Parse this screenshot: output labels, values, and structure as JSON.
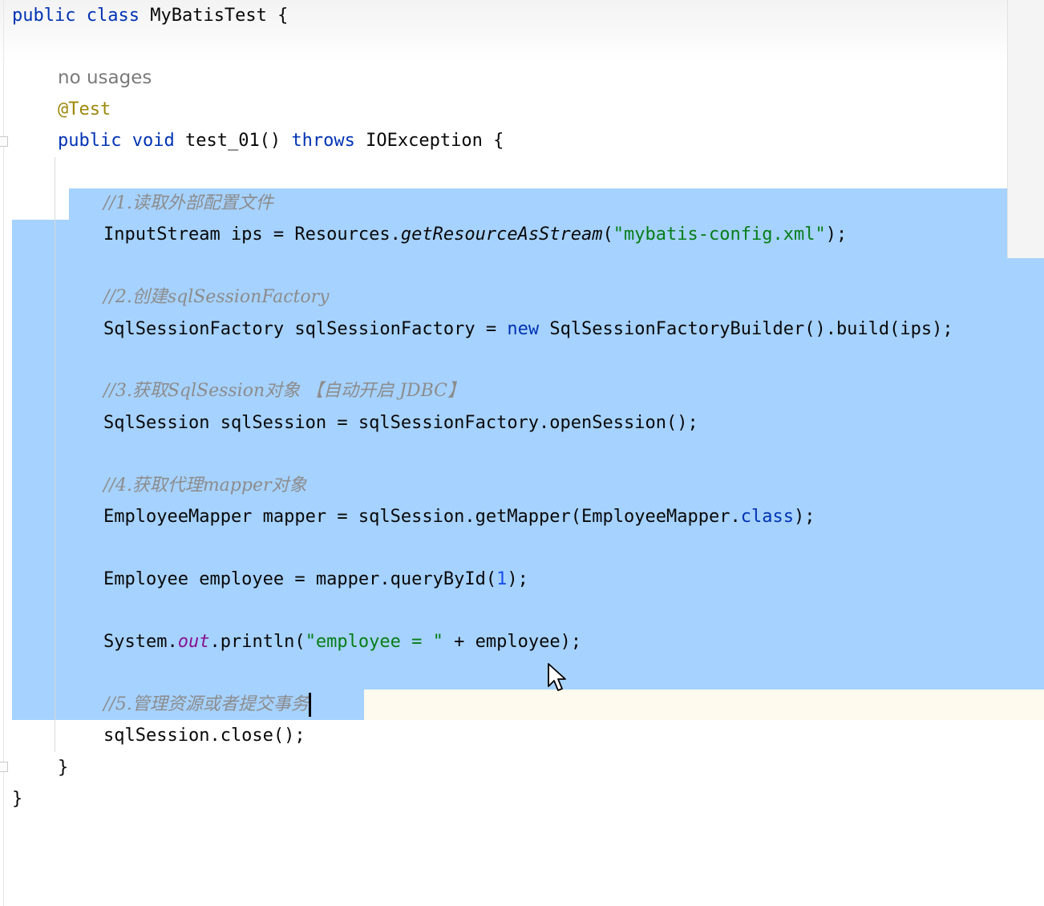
{
  "code": {
    "class_decl": {
      "kw1": "public",
      "kw2": "class",
      "name": "MyBatisTest",
      "brace": "{"
    },
    "usage_hint": "no usages",
    "annotation": "@Test",
    "method_decl": {
      "kw1": "public",
      "kw2": "void",
      "name": "test_01()",
      "kw3": "throws",
      "exception": "IOException",
      "brace": "{"
    },
    "comment1": "//1.读取外部配置文件",
    "line_ips": {
      "a": "InputStream ips = Resources.",
      "method": "getResourceAsStream",
      "b": "(",
      "str": "\"mybatis-config.xml\"",
      "c": ");"
    },
    "comment2": "//2.创建sqlSessionFactory",
    "line_factory": {
      "a": "SqlSessionFactory sqlSessionFactory = ",
      "kw": "new",
      "b": " SqlSessionFactoryBuilder().build(ips);"
    },
    "comment3": "//3.获取SqlSession对象 【自动开启 JDBC】",
    "line_session": "SqlSession sqlSession = sqlSessionFactory.openSession();",
    "comment4": "//4.获取代理mapper对象",
    "line_mapper": {
      "a": "EmployeeMapper mapper = sqlSession.getMapper(EmployeeMapper.",
      "kw": "class",
      "b": ");"
    },
    "line_employee": {
      "a": "Employee employee = mapper.queryById(",
      "num": "1",
      "b": ");"
    },
    "line_print": {
      "a": "System.",
      "field": "out",
      "b": ".println(",
      "str": "\"employee = \"",
      "c": " + employee);"
    },
    "comment5": "//5.管理资源或者提交事务",
    "line_close": "sqlSession.close();",
    "method_close": "}",
    "class_close": "}"
  },
  "colors": {
    "selection": "#a6d2ff",
    "keyword": "#0033b3",
    "annotation": "#9e880d",
    "string": "#067d17",
    "number": "#1750eb",
    "comment": "#8c8c8c",
    "field": "#871094"
  }
}
